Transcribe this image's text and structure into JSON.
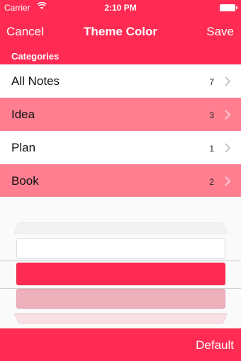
{
  "status_bar": {
    "carrier": "Carrier",
    "time": "2:10 PM",
    "wifi_icon": "wifi-icon",
    "battery_icon": "battery-icon"
  },
  "nav": {
    "left": "Cancel",
    "title": "Theme Color",
    "right": "Save"
  },
  "section": {
    "title": "Categories"
  },
  "categories": [
    {
      "label": "All Notes",
      "count": "7"
    },
    {
      "label": "Idea",
      "count": "3"
    },
    {
      "label": "Plan",
      "count": "1"
    },
    {
      "label": "Book",
      "count": "2"
    }
  ],
  "colors": {
    "accent": "#ff2b52",
    "row_alt": "#ff7f91",
    "picker_options": [
      "#f2f2f2",
      "#ffffff",
      "#ff2b52",
      "#eeb0bb",
      "#f7dfe3"
    ],
    "selected": "#ff2b52"
  },
  "bottom": {
    "default": "Default"
  }
}
